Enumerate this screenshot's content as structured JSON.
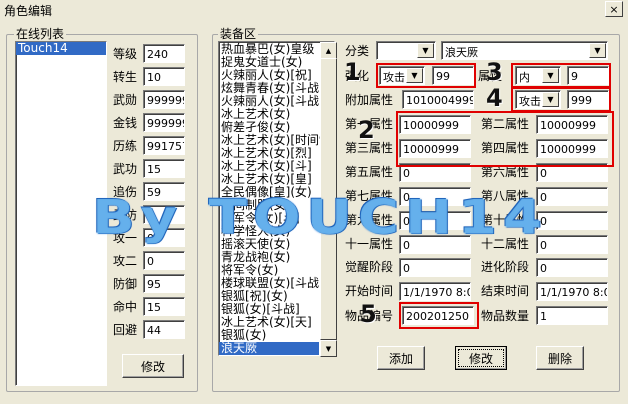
{
  "window": {
    "title": "角色编辑",
    "close_label": "×"
  },
  "online_group": {
    "legend": "在线列表",
    "players": [
      {
        "name": "Touch14",
        "selected": true
      }
    ],
    "fields": [
      {
        "label": "等级",
        "value": "240"
      },
      {
        "label": "转生",
        "value": "10"
      },
      {
        "label": "武勋",
        "value": "999999"
      },
      {
        "label": "金钱",
        "value": "999999"
      },
      {
        "label": "历练",
        "value": "991757"
      },
      {
        "label": "武功",
        "value": "15"
      },
      {
        "label": "追伤",
        "value": "59"
      },
      {
        "label": "武防",
        "value": "0"
      },
      {
        "label": "攻一",
        "value": "0"
      },
      {
        "label": "攻二",
        "value": "0"
      },
      {
        "label": "防御",
        "value": "95"
      },
      {
        "label": "命中",
        "value": "15"
      },
      {
        "label": "回避",
        "value": "44"
      }
    ],
    "modify_label": "修改"
  },
  "equipment_group": {
    "legend": "装备区",
    "items": [
      {
        "name": "热血暴巴(女)皇级",
        "selected": false
      },
      {
        "name": "捉鬼女道士(女)",
        "selected": false
      },
      {
        "name": "火辣丽人(女)[祝]",
        "selected": false
      },
      {
        "name": "炫舞青春(女)[斗战]",
        "selected": false
      },
      {
        "name": "火辣丽人(女)[斗战]",
        "selected": false
      },
      {
        "name": "冰上艺术(女)",
        "selected": false
      },
      {
        "name": "俯差孑俊(女)",
        "selected": false
      },
      {
        "name": "冰上艺术(女)[时间制]",
        "selected": false
      },
      {
        "name": "冰上艺术(女)[烈]",
        "selected": false
      },
      {
        "name": "冰上艺术(女)[斗]",
        "selected": false
      },
      {
        "name": "冰上艺术(女)[皇]",
        "selected": false
      },
      {
        "name": "全民偶像[皇](女)",
        "selected": false
      },
      {
        "name": "空间制服(女)",
        "selected": false
      },
      {
        "name": "将军令(女)[斗]",
        "selected": false
      },
      {
        "name": "科学怪人(女)",
        "selected": false
      },
      {
        "name": "摇滚天使(女)",
        "selected": false
      },
      {
        "name": "青龙战袍(女)",
        "selected": false
      },
      {
        "name": "将军令(女)",
        "selected": false
      },
      {
        "name": "楼球联盟(女)[斗战]",
        "selected": false
      },
      {
        "name": "银狐[祝](女)",
        "selected": false
      },
      {
        "name": "银狐(女)[斗战]",
        "selected": false
      },
      {
        "name": "冰上艺术(女)[天]",
        "selected": false
      },
      {
        "name": "银狐(女)",
        "selected": false
      },
      {
        "name": "浪天厥",
        "selected": true
      }
    ],
    "category_label": "分类",
    "category_value": "",
    "name_value": "浪天厥",
    "attr1_label": "强化",
    "attr1_type": "攻击",
    "attr1_value": "99",
    "attr2_label": "属性",
    "attr2_type": "内",
    "attr2_value": "9",
    "extra_label": "附加属性",
    "extra_value": "1010004999",
    "extra_type": "攻击",
    "extra_type_value": "999",
    "attrs": [
      {
        "label": "第一属性",
        "value": "10000999"
      },
      {
        "label": "第二属性",
        "value": "10000999"
      },
      {
        "label": "第三属性",
        "value": "10000999"
      },
      {
        "label": "第四属性",
        "value": "10000999"
      },
      {
        "label": "第五属性",
        "value": "0"
      },
      {
        "label": "第六属性",
        "value": "0"
      },
      {
        "label": "第七属性",
        "value": "0"
      },
      {
        "label": "第八属性",
        "value": "0"
      },
      {
        "label": "第九属性",
        "value": "0"
      },
      {
        "label": "第十属性",
        "value": "0"
      },
      {
        "label": "十一属性",
        "value": "0"
      },
      {
        "label": "十二属性",
        "value": "0"
      }
    ],
    "awaken_label": "觉醒阶段",
    "awaken_value": "0",
    "evolve_label": "进化阶段",
    "evolve_value": "0",
    "start_label": "开始时间",
    "start_value": "1/1/1970 8:00",
    "end_label": "结束时间",
    "end_value": "1/1/1970 8:00",
    "item_id_label": "物品编号",
    "item_id_value": "200201250",
    "qty_label": "物品数量",
    "qty_value": "1",
    "add_label": "添加",
    "modify_label": "修改",
    "delete_label": "删除"
  },
  "annotations": {
    "b1": "1",
    "b2": "2",
    "b3": "3",
    "b4": "4",
    "b5": "5",
    "watermark": "By TOUCH14"
  },
  "colors": {
    "selection": "#316ac5",
    "annotation_red": "#e00000",
    "watermark": "#7fcfff"
  }
}
